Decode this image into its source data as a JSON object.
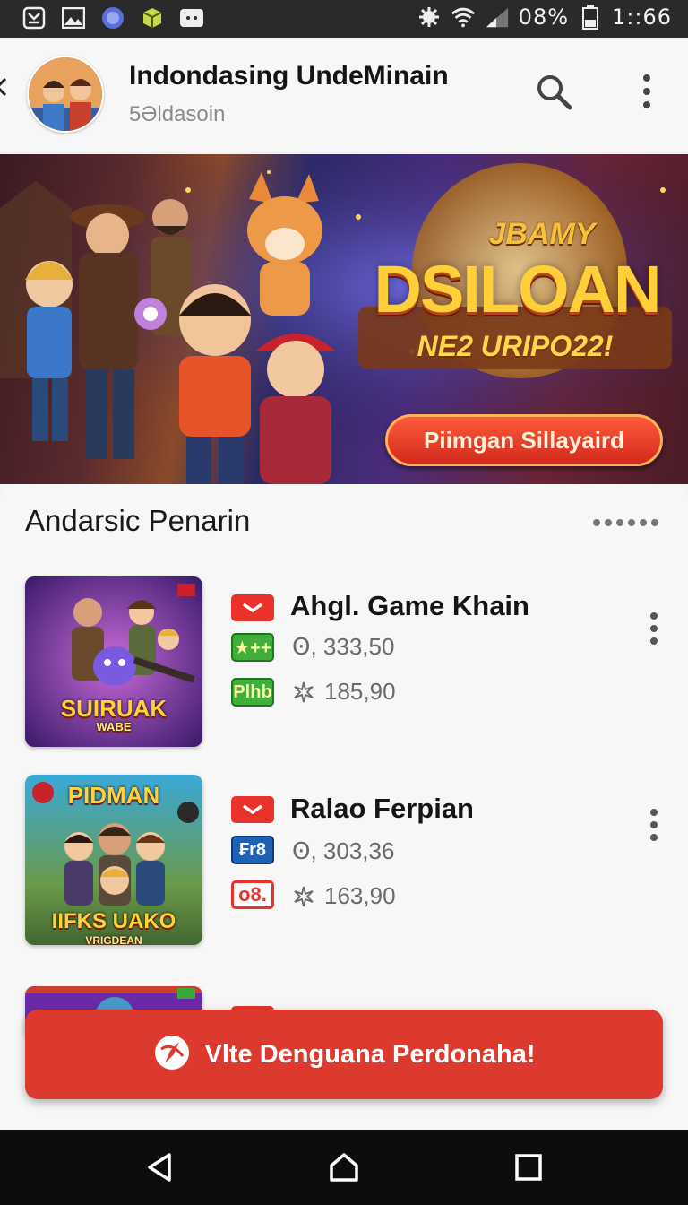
{
  "status_bar": {
    "battery": "08%",
    "time": "1::66",
    "icons": [
      "app-icon",
      "image-icon",
      "globe-icon",
      "game-icon",
      "chat-icon",
      "alarm-icon",
      "wifi-icon",
      "signal-icon",
      "battery-icon"
    ]
  },
  "header": {
    "title": "Indondasing UndeMinain",
    "subtitle": "5Əldasoin",
    "icons": [
      "back-icon",
      "search-icon",
      "more-vert-icon"
    ]
  },
  "banner": {
    "kicker": "JBAMY",
    "title": "DSILOAN",
    "tagline": "NE2 URIPO22!",
    "cta_label": "Piimgan Sillayaird"
  },
  "section": {
    "title": "Andarsic Penarin"
  },
  "games": [
    {
      "title": "Ahgl. Game Khain",
      "thumb_title": "SUIRUAK",
      "thumb_subtitle": "WABE",
      "badge_1": "★++",
      "badge_2": "Plhb",
      "stat_1": "Ꙩ, 333,50",
      "stat_2": "185,90"
    },
    {
      "title": "Ralao Ferpian",
      "thumb_title": "PIDMAN",
      "thumb_subtitle": "VRIGDEAN",
      "thumb_bottom": "IIFKS UAKO",
      "badge_1": "₣r8",
      "badge_2": "o8.",
      "stat_1": "Ꙩ, 303,36",
      "stat_2": "163,90"
    }
  ],
  "fab": {
    "label": "Vlte Denguana Perdonaha!"
  },
  "colors": {
    "accent_red": "#dc3a2e",
    "banner_gold": "#ffcf3a",
    "status_bar": "#2a2a2a"
  }
}
